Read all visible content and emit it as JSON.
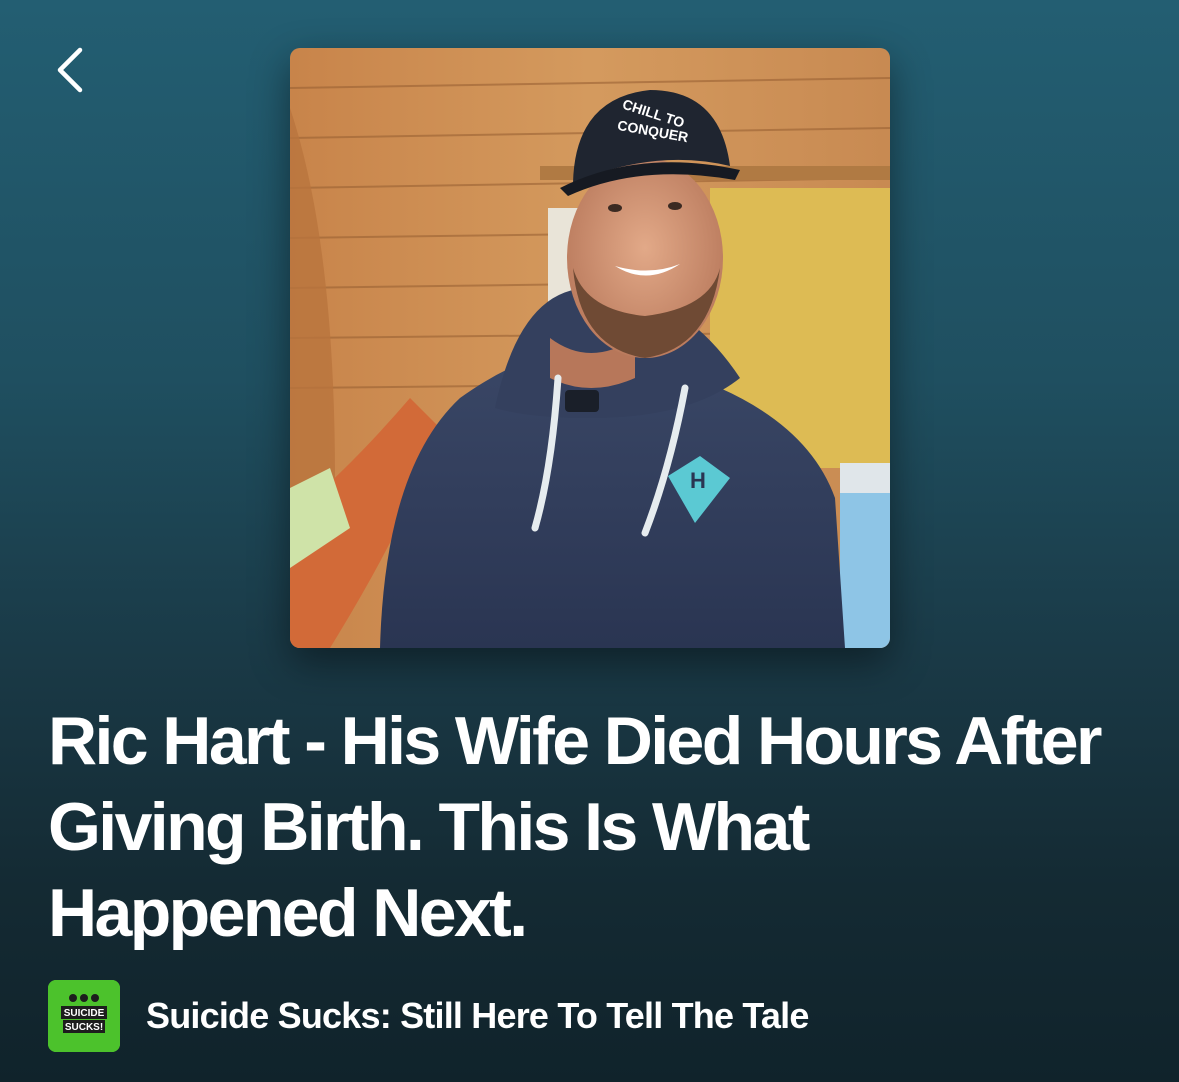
{
  "header": {
    "back_icon": "chevron-left-icon"
  },
  "cover": {
    "hat_line1": "CHILL TO",
    "hat_line2": "CONQUER"
  },
  "episode": {
    "title": "Ric Hart - His Wife Died Hours After Giving Birth. This Is What Happened Next."
  },
  "show": {
    "name": "Suicide Sucks: Still Here To Tell The Tale",
    "thumb_line1": "SUICIDE",
    "thumb_line2": "SUCKS!",
    "thumb_color": "#4cc22c"
  },
  "colors": {
    "background_top": "#235e72",
    "background_bottom": "#10232b",
    "text": "#ffffff"
  }
}
